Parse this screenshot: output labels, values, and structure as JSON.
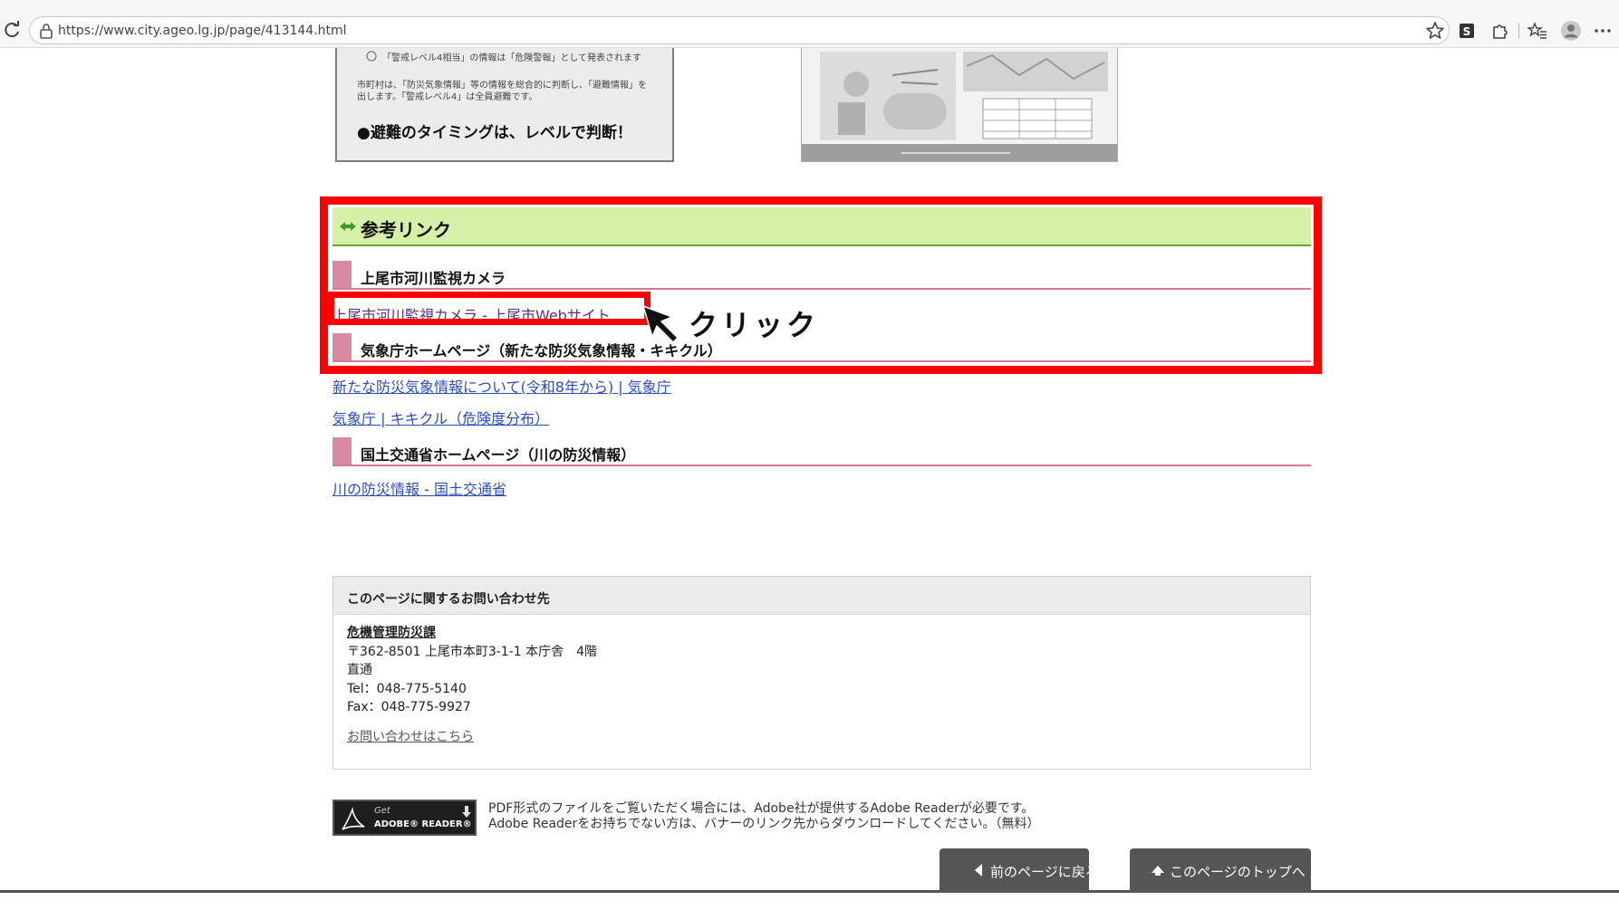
{
  "browser": {
    "url": "https://www.city.ageo.lg.jp/page/413144.html",
    "icons": [
      "reload-icon",
      "lock-icon",
      "star-icon",
      "s-extension-icon",
      "extensions-icon",
      "favorites-icon",
      "profile-icon",
      "more-icon"
    ]
  },
  "flyer_left": {
    "line1": "「警戒レベル4相当」の情報は「危険警報」として発表されます",
    "line2": "市町村は、「防災気象情報」等の情報を総合的に判断し、「避難情報」を",
    "line3": "出します。「警戒レベル4」は全員避難です。",
    "headline": "●避難のタイミングは、レベルで判断！"
  },
  "section": {
    "title": "参考リンク"
  },
  "groups": [
    {
      "heading": "上尾市河川監視カメラ",
      "links": [
        "上尾市河川監視カメラ - 上尾市Webサイト"
      ]
    },
    {
      "heading": "気象庁ホームページ（新たな防災気象情報・キキクル）",
      "links": [
        "新たな防災気象情報について(令和8年から) | 気象庁",
        "気象庁 | キキクル（危険度分布）"
      ]
    },
    {
      "heading": "国土交通省ホームページ（川の防災情報）",
      "links": [
        "川の防災情報 - 国土交通省"
      ]
    }
  ],
  "annotation": {
    "click_label": "クリック",
    "frame_color": "#ff0000"
  },
  "contact": {
    "heading": "このページに関するお問い合わせ先",
    "department": "危機管理防災課",
    "address": "〒362-8501 上尾市本町3-1-1 本庁舎　4階",
    "direct": "直通",
    "tel": "Tel：048-775-5140",
    "fax": "Fax：048-775-9927",
    "inquiry_link": "お問い合わせはこちら"
  },
  "adobe": {
    "badge_get": "Get",
    "badge_name": "ADOBE® READER®",
    "text_line1": "PDF形式のファイルをご覧いただく場合には、Adobe社が提供するAdobe Readerが必要です。",
    "text_line2": "Adobe Readerをお持ちでない方は、バナーのリンク先からダウンロードしてください。（無料）"
  },
  "footer": {
    "back_label": "前のページに戻る",
    "top_label": "このページのトップへ"
  },
  "colors": {
    "section_bg": "#d6f0a8",
    "section_border": "#6ba534",
    "subhead_bar": "#d88aa2",
    "link": "#2a4cbf",
    "visited_link": "#5b2e86"
  }
}
